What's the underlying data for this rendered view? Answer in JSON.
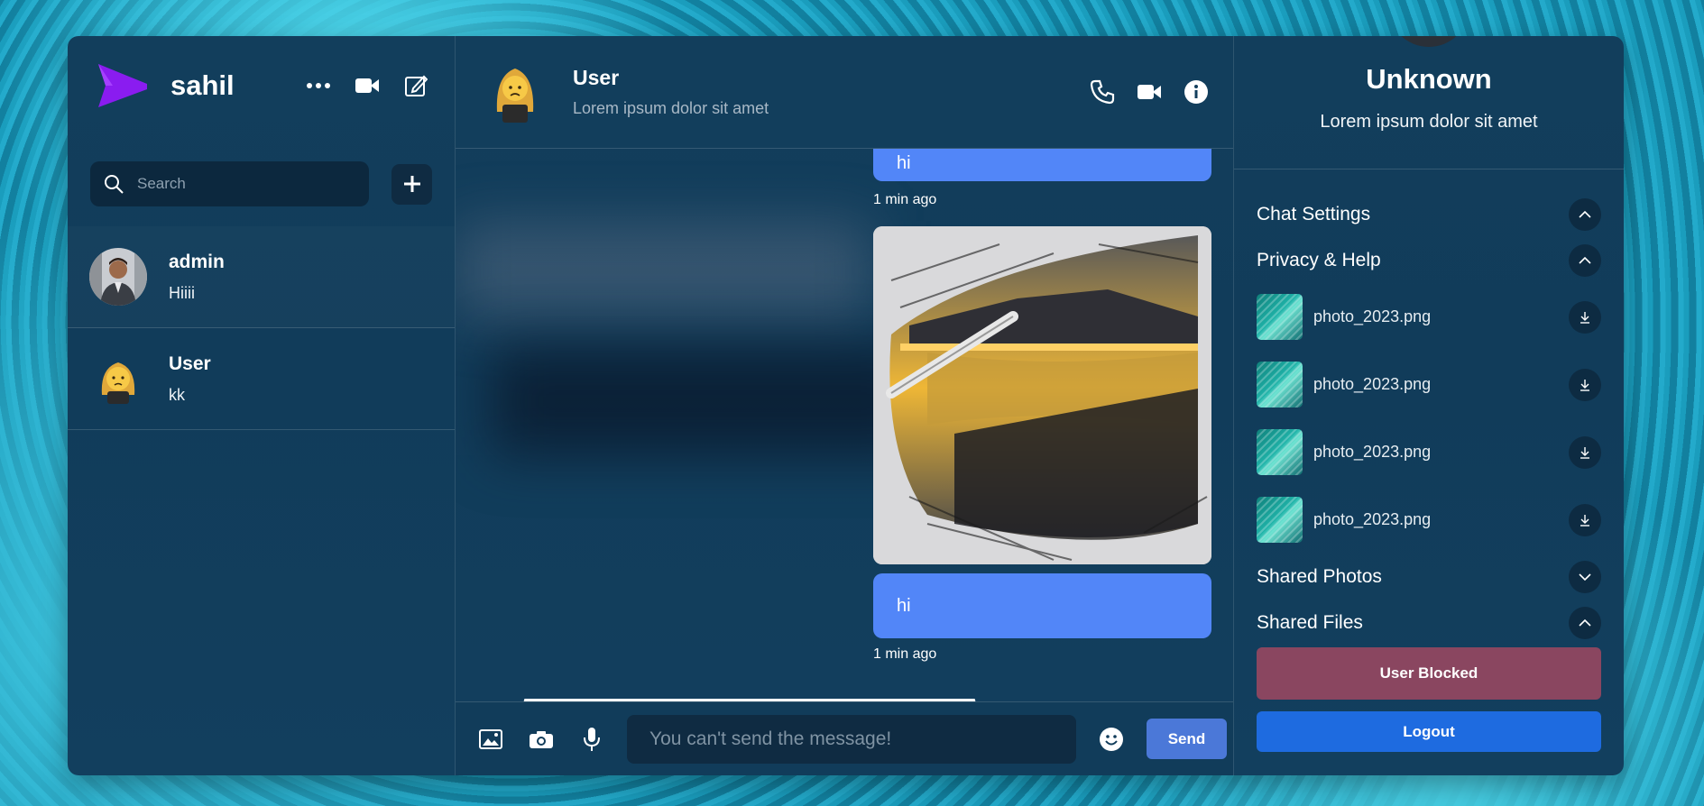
{
  "sidebar": {
    "brand_name": "sahil",
    "search_placeholder": "Search",
    "chats": [
      {
        "name": "admin",
        "last_message": "Hiiii"
      },
      {
        "name": "User",
        "last_message": "kk"
      }
    ]
  },
  "chat": {
    "header": {
      "name": "User",
      "status": "Lorem ipsum dolor sit amet"
    },
    "messages": [
      {
        "text": "hi",
        "time": "1 min ago"
      },
      {
        "image": "sketch-landscape-photo",
        "text": "hi",
        "time": "1 min ago"
      }
    ],
    "composer": {
      "placeholder": "You can't send the message!",
      "send_label": "Send"
    }
  },
  "details": {
    "name": "Unknown",
    "status": "Lorem ipsum dolor sit amet",
    "sections": {
      "chat_settings": "Chat Settings",
      "privacy_help": "Privacy & Help",
      "shared_photos": "Shared Photos",
      "shared_files": "Shared Files"
    },
    "files": [
      "photo_2023.png",
      "photo_2023.png",
      "photo_2023.png",
      "photo_2023.png"
    ],
    "block_label": "User Blocked",
    "logout_label": "Logout"
  },
  "colors": {
    "accent": "#5286f8",
    "logo": "#8a1cf0",
    "blocked": "#8a4660",
    "logout": "#1e6be0"
  }
}
